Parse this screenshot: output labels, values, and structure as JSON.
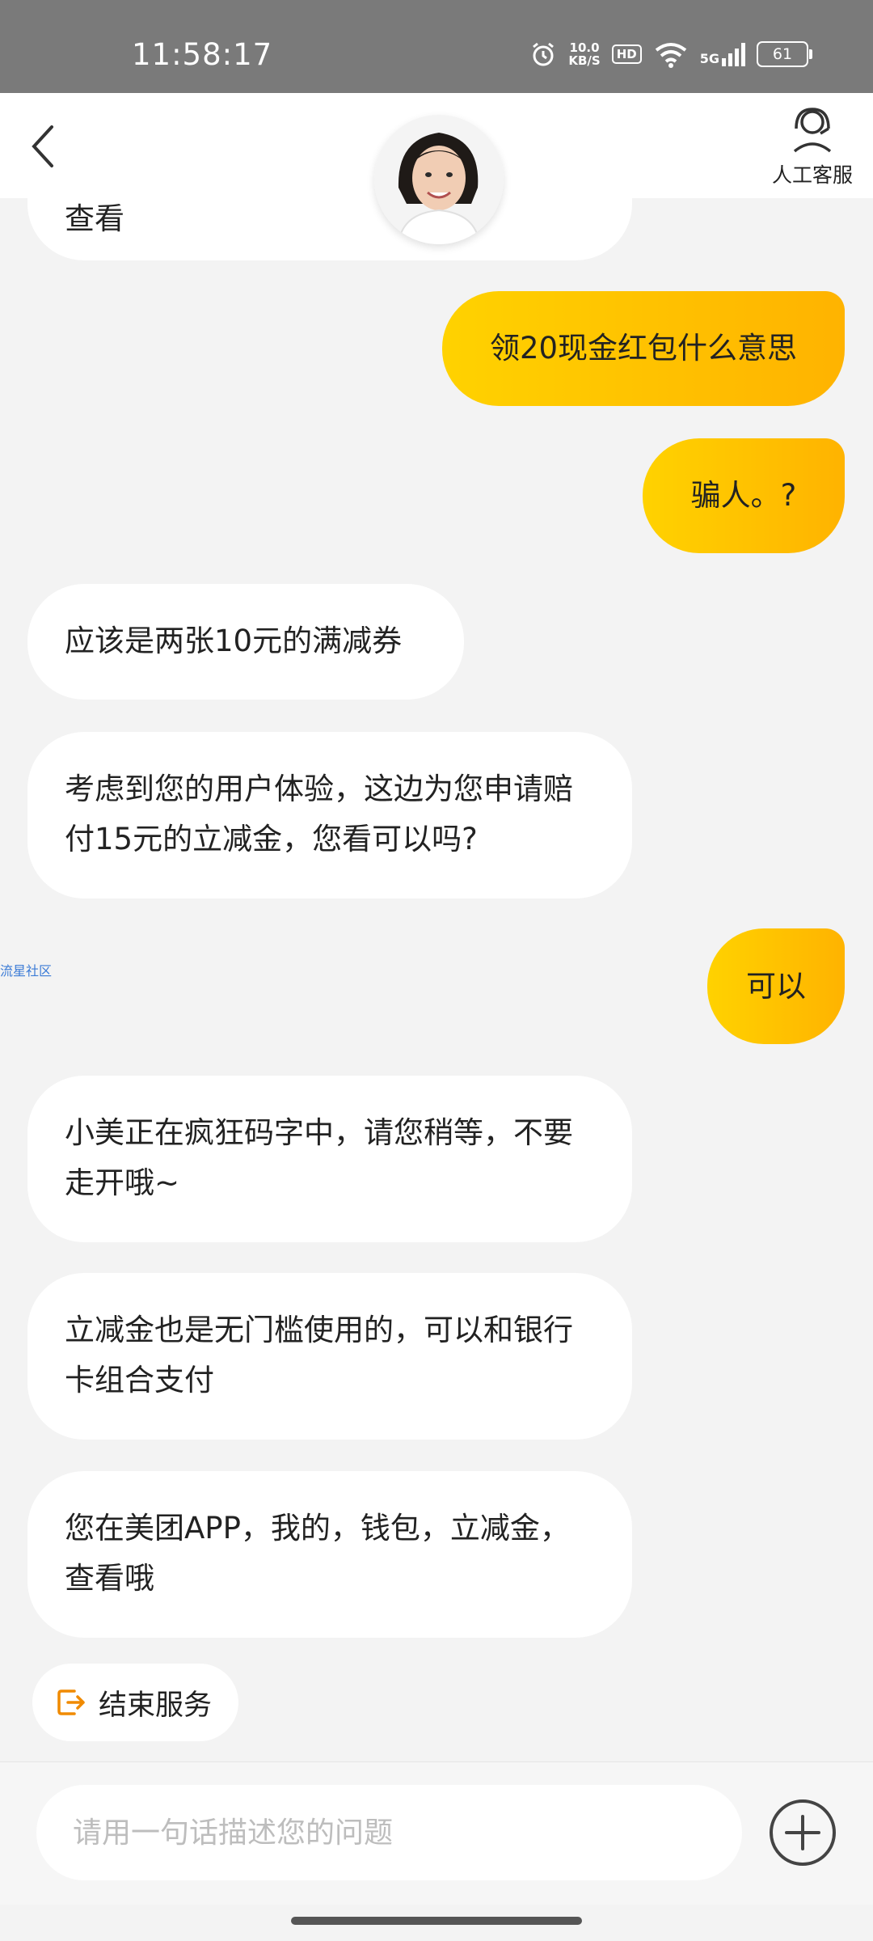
{
  "status_bar": {
    "time": "11:58:17",
    "net_speed_value": "10.0",
    "net_speed_unit": "KB/S",
    "hd": "HD",
    "network": "5G",
    "battery": "61"
  },
  "header": {
    "customer_service_label": "人工客服"
  },
  "messages": [
    {
      "side": "left",
      "text": "查看"
    },
    {
      "side": "right",
      "text": "领20现金红包什么意思"
    },
    {
      "side": "right",
      "text": "骗人。?"
    },
    {
      "side": "left",
      "text": "应该是两张10元的满减券"
    },
    {
      "side": "left",
      "text": "考虑到您的用户体验，这边为您申请赔付15元的立减金，您看可以吗?"
    },
    {
      "side": "right",
      "text": "可以"
    },
    {
      "side": "left",
      "text": "小美正在疯狂码字中，请您稍等，不要走开哦~"
    },
    {
      "side": "left",
      "text": "立减金也是无门槛使用的，可以和银行卡组合支付"
    },
    {
      "side": "left",
      "text": "您在美团APP，我的，钱包，立减金，查看哦"
    }
  ],
  "watermark": "流星社区",
  "end_service_label": "结束服务",
  "input": {
    "placeholder": "请用一句话描述您的问题",
    "value": ""
  },
  "colors": {
    "accent_yellow": "#ffc400",
    "accent_orange": "#f08a00",
    "background": "#f3f3f3"
  },
  "icons": {
    "back": "chevron-left-icon",
    "customer_service": "headset-icon",
    "end_service": "exit-icon",
    "plus": "plus-circle-icon"
  }
}
